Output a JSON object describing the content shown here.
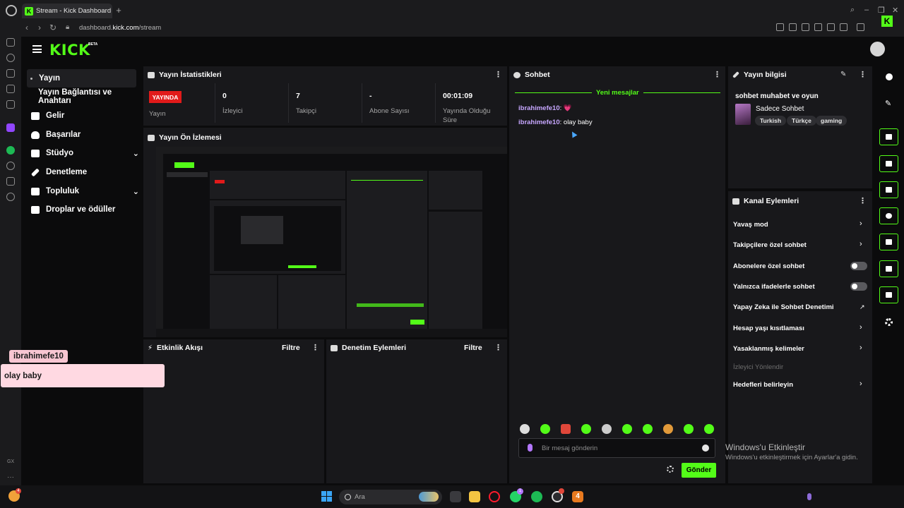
{
  "browser": {
    "tab_title": "Stream - Kick Dashboard",
    "url_prefix": "dashboard.",
    "url_domain": "kick.com",
    "url_path": "/stream"
  },
  "header": {
    "logo": "KICK",
    "beta": "BETA"
  },
  "nav": {
    "items": [
      {
        "label": "Yayın",
        "icon": "broadcast-icon"
      },
      {
        "label": "Yayın Bağlantısı ve Anahtarı",
        "icon": ""
      },
      {
        "label": "Gelir",
        "icon": "revenue-icon"
      },
      {
        "label": "Başarılar",
        "icon": "trophy-icon"
      },
      {
        "label": "Stüdyo",
        "icon": "studio-icon"
      },
      {
        "label": "Denetleme",
        "icon": "hammer-icon"
      },
      {
        "label": "Topluluk",
        "icon": "community-icon"
      },
      {
        "label": "Droplar ve ödüller",
        "icon": "drops-icon"
      }
    ]
  },
  "stats": {
    "title": "Yayın İstatistikleri",
    "live_badge": "YAYINDA",
    "live_label": "Yayın",
    "viewers_value": "0",
    "viewers_label": "İzleyici",
    "followers_value": "7",
    "followers_label": "Takipçi",
    "subs_value": "-",
    "subs_label": "Abone Sayısı",
    "uptime_value": "00:01:09",
    "uptime_label_1": "Yayında Olduğu",
    "uptime_label_2": "Süre"
  },
  "preview": {
    "title": "Yayın Ön İzlemesi"
  },
  "activity": {
    "title": "Etkinlik Akışı",
    "filter": "Filtre"
  },
  "moderation": {
    "title": "Denetim Eylemleri",
    "filter": "Filtre"
  },
  "chat": {
    "title": "Sohbet",
    "new_messages": "Yeni mesajlar",
    "messages": [
      {
        "user": "ibrahimefe10",
        "text": "💗"
      },
      {
        "user": "ibrahimefe10",
        "text": "olay baby"
      }
    ],
    "input_placeholder": "Bir mesaj gönderin",
    "send_label": "Gönder"
  },
  "stream_info": {
    "title": "Yayın bilgisi",
    "stream_title": "sohbet muhabet ve oyun",
    "category": "Sadece Sohbet",
    "tags": [
      "Turkish",
      "Türkçe",
      "gaming"
    ]
  },
  "channel_actions": {
    "title": "Kanal Eylemleri",
    "items": [
      {
        "label": "Yavaş mod",
        "control": "chevron"
      },
      {
        "label": "Takipçilere özel sohbet",
        "control": "chevron"
      },
      {
        "label": "Abonelere özel sohbet",
        "control": "toggle"
      },
      {
        "label": "Yalnızca ifadelerle sohbet",
        "control": "toggle"
      },
      {
        "label": "Yapay Zeka ile Sohbet Denetimi",
        "control": "external"
      },
      {
        "label": "Hesap yaşı kısıtlaması",
        "control": "chevron"
      },
      {
        "label": "Yasaklanmış kelimeler",
        "control": "chevron"
      },
      {
        "label": "İzleyici Yönlendir",
        "control": "disabled"
      },
      {
        "label": "Hedefleri belirleyin",
        "control": "chevron"
      }
    ]
  },
  "overlay": {
    "user": "ibrahimefe10",
    "message": "olay baby"
  },
  "watermark": {
    "line1": "Windows'u Etkinleştir",
    "line2": "Windows'u etkinleştirmek için Ayarlar'a gidin."
  },
  "taskbar": {
    "search_label": "Ara",
    "edge_badge": "4"
  },
  "colors": {
    "accent": "#53fc18",
    "live": "#e11a1a",
    "chat_user": "#c7a7ff",
    "panel": "#18181b"
  }
}
